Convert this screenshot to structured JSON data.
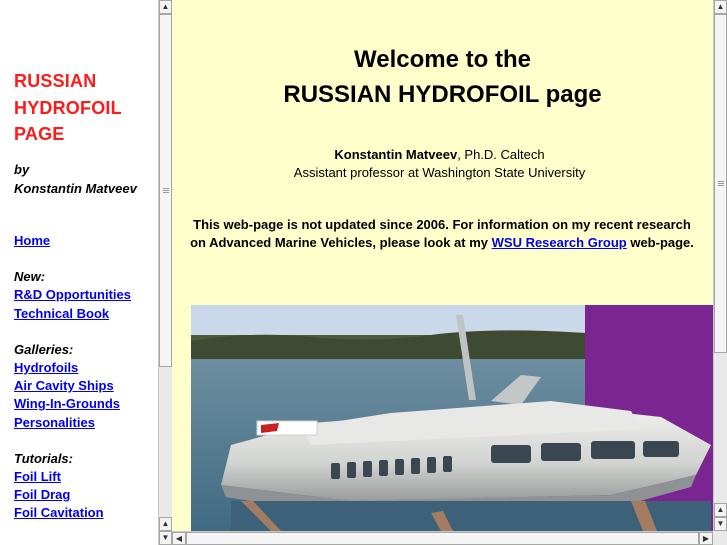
{
  "sidebar": {
    "title_lines": [
      "RUSSIAN",
      "HYDROFOIL",
      "PAGE"
    ],
    "byline": [
      "by",
      "Konstantin Matveev"
    ],
    "home": "Home",
    "sections": [
      {
        "heading": "New:",
        "links": [
          "R&D Opportunities",
          "Technical Book"
        ]
      },
      {
        "heading": "Galleries:",
        "links": [
          "Hydrofoils",
          "Air Cavity Ships",
          "Wing-In-Grounds",
          "Personalities"
        ]
      },
      {
        "heading": "Tutorials:",
        "links": [
          "Foil Lift",
          "Foil Drag",
          "Foil Cavitation"
        ]
      }
    ]
  },
  "main": {
    "welcome_lines": [
      "Welcome to the",
      "RUSSIAN HYDROFOIL page"
    ],
    "author_name": "Konstantin Matveev",
    "author_degree": ", Ph.D. Caltech",
    "author_position": "Assistant professor at Washington State University",
    "notice_before": "This web-page is not updated since 2006. For information on my recent research on Advanced Marine Vehicles, please look at my ",
    "notice_link": "WSU Research Group",
    "notice_after": " web-page."
  },
  "colors": {
    "title_red": "#ff1a1a",
    "link_blue": "#0000ee",
    "main_background": "#ffffcc",
    "photo_purple": "#7a2590"
  },
  "icons": {
    "scroll_up": "arrow-up-icon",
    "scroll_down": "arrow-down-icon",
    "scroll_left": "arrow-left-icon",
    "scroll_right": "arrow-right-icon"
  }
}
